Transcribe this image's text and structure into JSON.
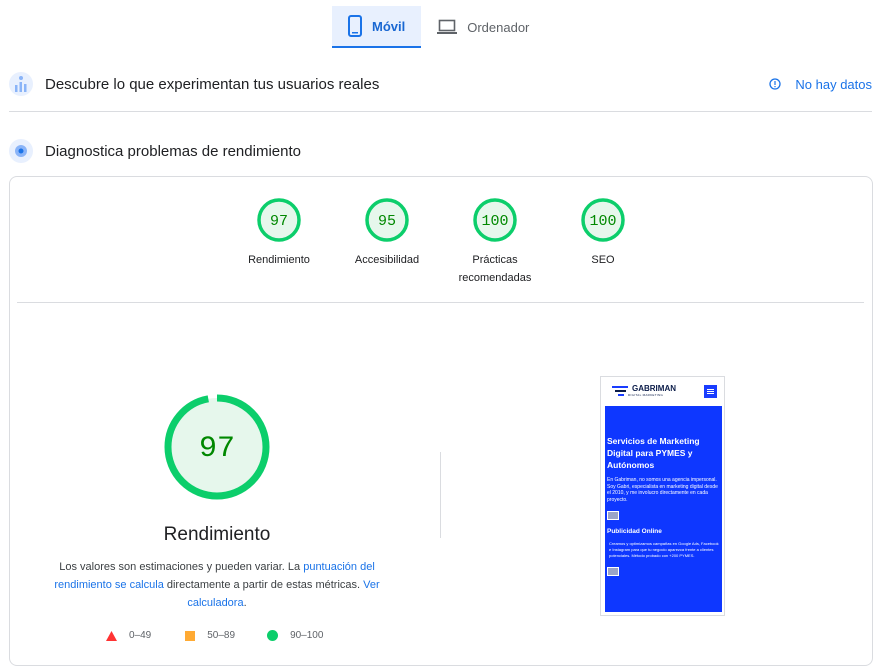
{
  "tabs": [
    {
      "label": "Móvil",
      "icon": "phone-icon",
      "active": true
    },
    {
      "label": "Ordenador",
      "icon": "laptop-icon",
      "active": false
    }
  ],
  "field_data": {
    "title": "Descubre lo que experimentan tus usuarios reales",
    "status": "No hay datos",
    "icon": "users-chart-icon"
  },
  "lab_data": {
    "title": "Diagnostica problemas de rendimiento",
    "icon": "lab-flask-icon"
  },
  "scores": [
    {
      "value": "97",
      "label": "Rendimiento"
    },
    {
      "value": "95",
      "label": "Accesibilidad"
    },
    {
      "value": "100",
      "label": "Prácticas recomendadas"
    },
    {
      "value": "100",
      "label": "SEO"
    }
  ],
  "performance": {
    "score": "97",
    "title": "Rendimiento",
    "desc_part1": "Los valores son estimaciones y pueden variar. La ",
    "link1": "puntuación del rendimiento se calcula",
    "desc_part2": " directamente a partir de estas métricas. ",
    "link2": "Ver calculadora",
    "desc_part3": "."
  },
  "legend": [
    {
      "range": "0–49",
      "shape": "triangle",
      "color": "#ff3333"
    },
    {
      "range": "50–89",
      "shape": "square",
      "color": "#ffaa33"
    },
    {
      "range": "90–100",
      "shape": "circle",
      "color": "#0cce6b"
    }
  ],
  "colors": {
    "pass": "#0cce6b",
    "pass_bg": "#e6f7ec",
    "pass_text": "#008800",
    "accent": "#1a73e8"
  },
  "screenshot": {
    "logo_text": "GABRIMAN",
    "logo_sub": "DIGITAL MARKETING",
    "hero_title": "Servicios de Marketing Digital para PYMES y Autónomos",
    "hero_text": "En Gabriman, no somos una agencia impersonal. Soy Gabri, especialista en marketing digital desde el 2010, y me involucro directamente en cada proyecto.",
    "sub_title": "Publicidad Online",
    "sub_text": "Creamos y optimizamos campañas en Google Ads, Facebook e Instagram para que tu negocio aparezca frente a clientes potenciales. Método probado con +200 PYMES."
  }
}
